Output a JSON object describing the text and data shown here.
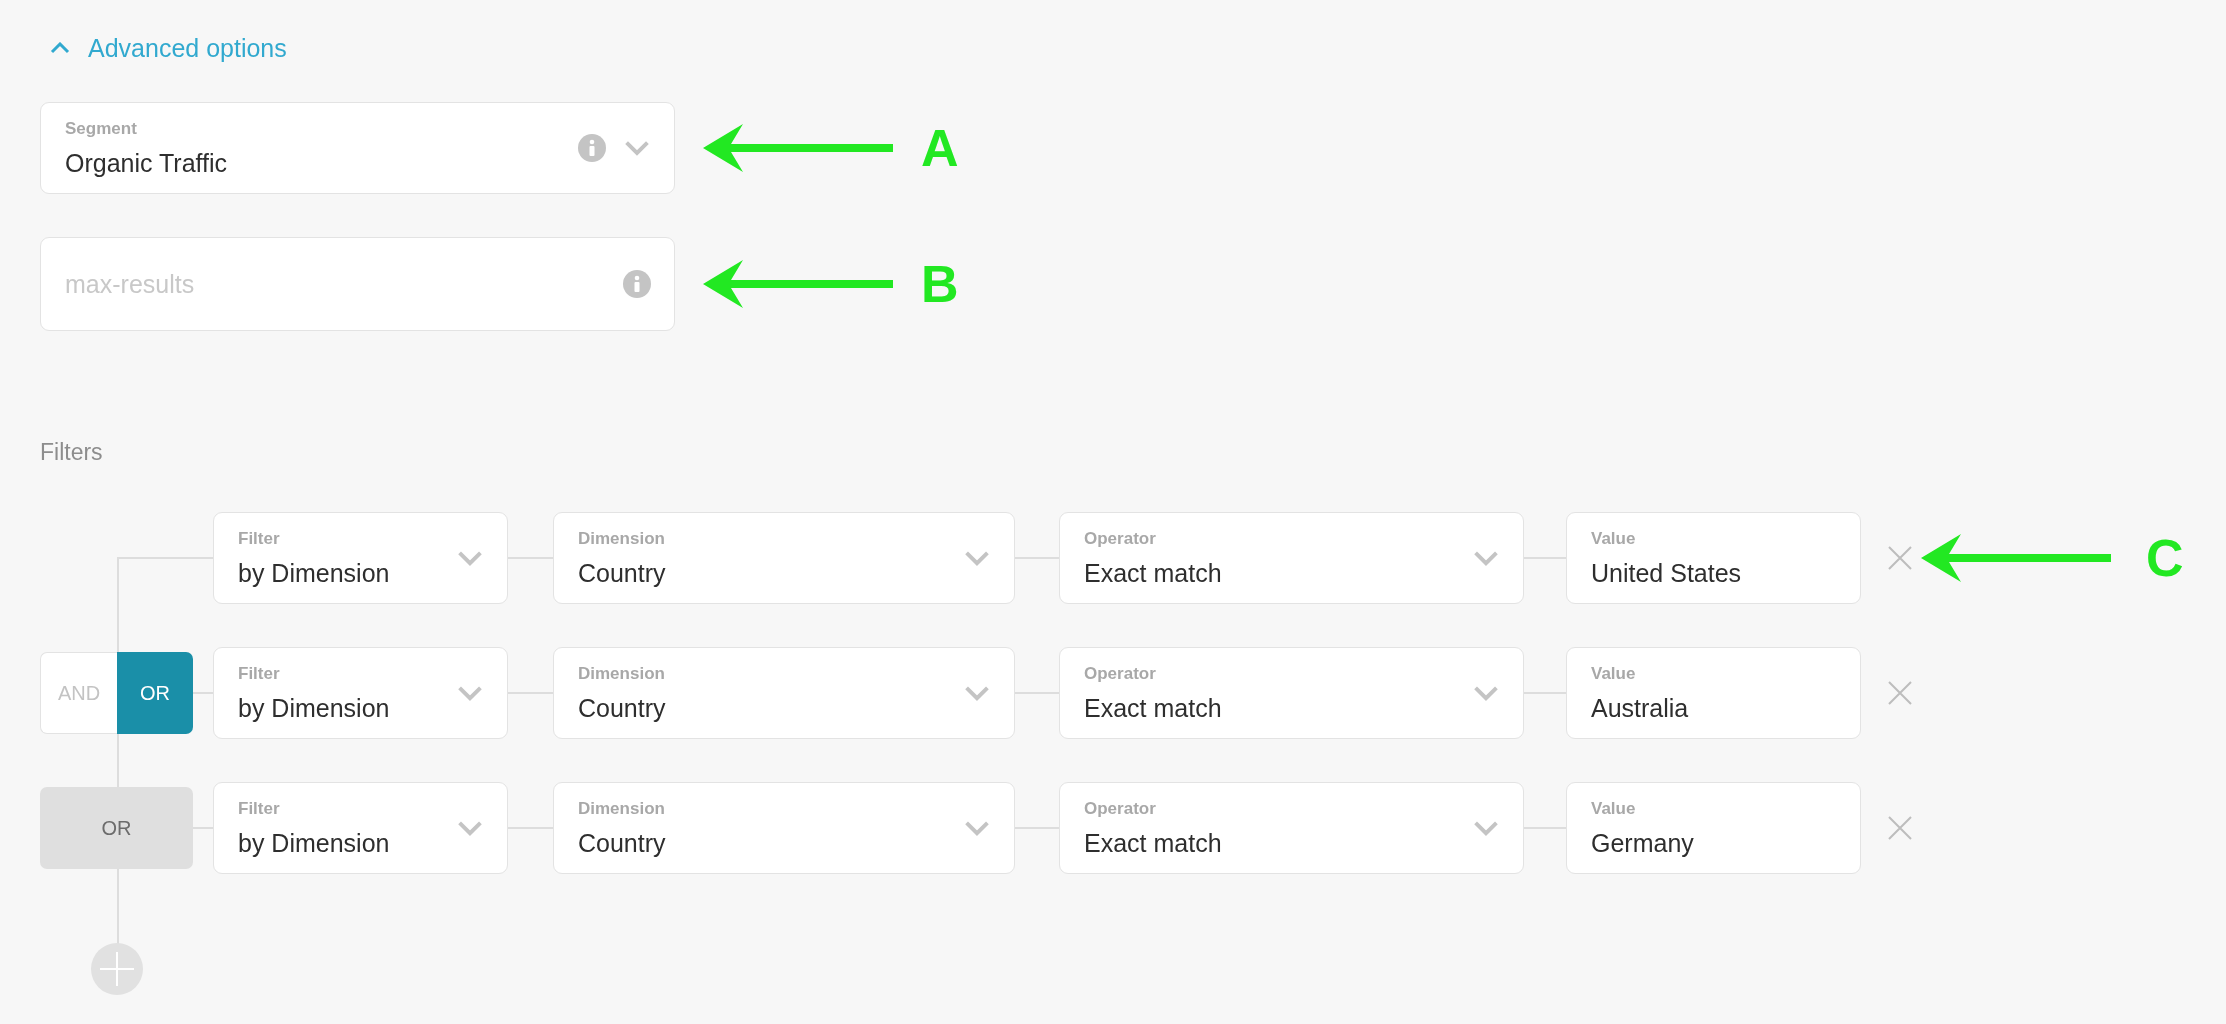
{
  "advanced_options": {
    "label": "Advanced options",
    "expanded": true
  },
  "segment": {
    "label": "Segment",
    "value": "Organic Traffic",
    "callout": "A"
  },
  "max_results": {
    "placeholder": "max-results",
    "callout": "B"
  },
  "filters": {
    "label": "Filters",
    "rows": [
      {
        "logic": {
          "kind": "none"
        },
        "filter": {
          "label": "Filter",
          "value": "by Dimension"
        },
        "dimension": {
          "label": "Dimension",
          "value": "Country"
        },
        "operator": {
          "label": "Operator",
          "value": "Exact match"
        },
        "value": {
          "label": "Value",
          "value": "United States"
        },
        "callout": "C"
      },
      {
        "logic": {
          "kind": "toggle",
          "options": [
            {
              "label": "AND",
              "selected": false
            },
            {
              "label": "OR",
              "selected": true
            }
          ]
        },
        "filter": {
          "label": "Filter",
          "value": "by Dimension"
        },
        "dimension": {
          "label": "Dimension",
          "value": "Country"
        },
        "operator": {
          "label": "Operator",
          "value": "Exact match"
        },
        "value": {
          "label": "Value",
          "value": "Australia"
        }
      },
      {
        "logic": {
          "kind": "badge",
          "label": "OR"
        },
        "filter": {
          "label": "Filter",
          "value": "by Dimension"
        },
        "dimension": {
          "label": "Dimension",
          "value": "Country"
        },
        "operator": {
          "label": "Operator",
          "value": "Exact match"
        },
        "value": {
          "label": "Value",
          "value": "Germany"
        }
      }
    ]
  }
}
